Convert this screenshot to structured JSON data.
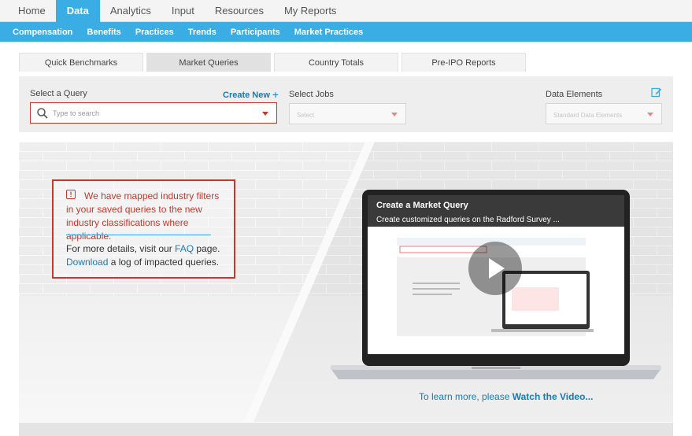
{
  "topnav": {
    "tabs": [
      "Home",
      "Data",
      "Analytics",
      "Input",
      "Resources",
      "My Reports"
    ],
    "active": "Data"
  },
  "subnav": {
    "items": [
      "Compensation",
      "Benefits",
      "Practices",
      "Trends",
      "Participants",
      "Market Practices"
    ],
    "active": "Compensation"
  },
  "query_tabs": {
    "items": [
      "Quick Benchmarks",
      "Market Queries",
      "Country Totals",
      "Pre-IPO Reports"
    ],
    "active": "Market Queries"
  },
  "query_bar": {
    "select_query_label": "Select a Query",
    "create_new_label": "Create New",
    "create_new_icon": "+",
    "search_placeholder": "Type to search",
    "select_jobs_label": "Select Jobs",
    "select_jobs_placeholder": "Select",
    "data_elements_label": "Data Elements",
    "data_elements_placeholder": "Standard Data Elements"
  },
  "notice": {
    "message": "We have mapped industry filters in your saved queries to the new industry classifications where applicable.",
    "more_prefix": "For more details, visit our ",
    "faq_link": "FAQ",
    "more_suffix": " page.",
    "download_link": "Download",
    "download_suffix": " a log of impacted queries."
  },
  "video": {
    "title": "Create a Market Query",
    "subtitle": "Create customized queries on the Radford Survey ..."
  },
  "learn_more": {
    "prefix": "To learn more, please ",
    "link": "Watch the Video..."
  },
  "colors": {
    "brand_blue": "#3aaee4",
    "link_blue": "#1a7ab3",
    "alert_red": "#c0392b"
  }
}
